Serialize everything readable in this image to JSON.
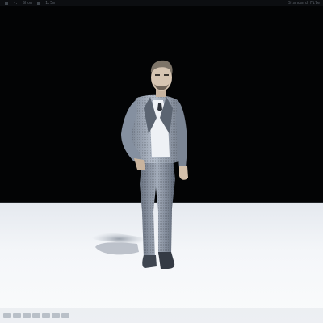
{
  "toolbar": {
    "items": [
      "·.",
      "Show",
      "1.5m"
    ],
    "right_label": "Standard    File"
  },
  "viewport": {
    "background_color": "#030405",
    "floor_color": "#f2f4f7",
    "subject": "man-in-suit-3d-model"
  },
  "bottom_controls": {
    "count": 7
  }
}
